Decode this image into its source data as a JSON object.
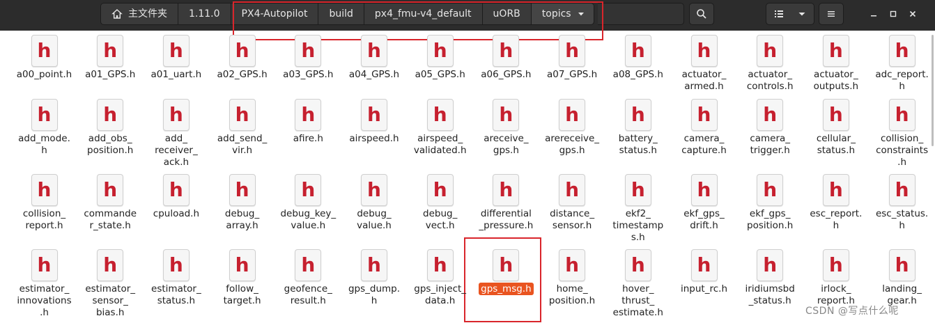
{
  "breadcrumbs": [
    "主文件夹",
    "1.11.0",
    "PX4-Autopilot",
    "build",
    "px4_fmu-v4_default",
    "uORB",
    "topics"
  ],
  "icons": {
    "home": "home-icon",
    "dropdown": "chevron-down-icon",
    "search": "search-icon",
    "list": "list-view-icon",
    "menu": "hamburger-menu-icon",
    "minimize": "minimize-icon",
    "maximize": "maximize-icon",
    "close": "close-icon",
    "file": "c-header-file-icon"
  },
  "file_icon_letter": "h",
  "accent": "#e95420",
  "annotation_color": "#d9252b",
  "selected_file": "gps_msg.h",
  "files": [
    "a00_point.h",
    "a01_GPS.h",
    "a01_uart.h",
    "a02_GPS.h",
    "a03_GPS.h",
    "a04_GPS.h",
    "a05_GPS.h",
    "a06_GPS.h",
    "a07_GPS.h",
    "a08_GPS.h",
    "actuator_\narmed.h",
    "actuator_\ncontrols.h",
    "actuator_\noutputs.h",
    "adc_report.\nh",
    "add_mode.\nh",
    "add_obs_\nposition.h",
    "add_\nreceiver_\nack.h",
    "add_send_\nvir.h",
    "afire.h",
    "airspeed.h",
    "airspeed_\nvalidated.h",
    "areceive_\ngps.h",
    "arereceive_\ngps.h",
    "battery_\nstatus.h",
    "camera_\ncapture.h",
    "camera_\ntrigger.h",
    "cellular_\nstatus.h",
    "collision_\nconstraints\n.h",
    "collision_\nreport.h",
    "commande\nr_state.h",
    "cpuload.h",
    "debug_\narray.h",
    "debug_key_\nvalue.h",
    "debug_\nvalue.h",
    "debug_\nvect.h",
    "differential\n_pressure.h",
    "distance_\nsensor.h",
    "ekf2_\ntimestamp\ns.h",
    "ekf_gps_\ndrift.h",
    "ekf_gps_\nposition.h",
    "esc_report.\nh",
    "esc_status.\nh",
    "estimator_\ninnovations\n.h",
    "estimator_\nsensor_\nbias.h",
    "estimator_\nstatus.h",
    "follow_\ntarget.h",
    "geofence_\nresult.h",
    "gps_dump.\nh",
    "gps_inject_\ndata.h",
    "gps_msg.h",
    "home_\nposition.h",
    "hover_\nthrust_\nestimate.h",
    "input_rc.h",
    "iridiumsbd\n_status.h",
    "irlock_\nreport.h",
    "landing_\ngear.h"
  ],
  "watermark": "CSDN @写点什么呢"
}
